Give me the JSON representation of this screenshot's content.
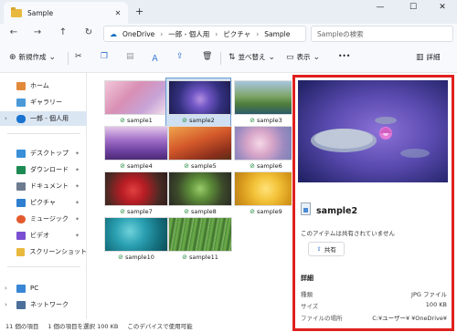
{
  "titlebar": {
    "tab_label": "Sample",
    "tab_close": "✕",
    "new_tab": "+",
    "minimize": "—",
    "maximize": "☐",
    "close": "✕"
  },
  "nav": {
    "back": "←",
    "forward": "→",
    "up": "↑",
    "refresh": "↻",
    "breadcrumb": [
      "OneDrive",
      "一郎 - 個人用",
      "ピクチャ",
      "Sample"
    ],
    "search_placeholder": "Sampleの検索"
  },
  "toolbar": {
    "new_label": "新規作成",
    "sort_label": "並べ替え",
    "view_label": "表示",
    "more": "•••",
    "details_label": "詳細"
  },
  "sidebar": {
    "items": [
      {
        "label": "ホーム",
        "icon": "home-icon"
      },
      {
        "label": "ギャラリー",
        "icon": "gallery-icon"
      },
      {
        "label": "一郎 - 個人用",
        "icon": "onedrive-icon"
      },
      {
        "label": "デスクトップ",
        "icon": "desktop-icon"
      },
      {
        "label": "ダウンロード",
        "icon": "download-icon"
      },
      {
        "label": "ドキュメント",
        "icon": "document-icon"
      },
      {
        "label": "ピクチャ",
        "icon": "pictures-icon"
      },
      {
        "label": "ミュージック",
        "icon": "music-icon"
      },
      {
        "label": "ビデオ",
        "icon": "video-icon"
      },
      {
        "label": "スクリーンショット",
        "icon": "folder-icon"
      },
      {
        "label": "PC",
        "icon": "pc-icon"
      },
      {
        "label": "ネットワーク",
        "icon": "network-icon"
      }
    ]
  },
  "files": [
    {
      "name": "sample1"
    },
    {
      "name": "sample2"
    },
    {
      "name": "sample3"
    },
    {
      "name": "sample4"
    },
    {
      "name": "sample5"
    },
    {
      "name": "sample6"
    },
    {
      "name": "sample7"
    },
    {
      "name": "sample8"
    },
    {
      "name": "sample9"
    },
    {
      "name": "sample10"
    },
    {
      "name": "sample11"
    }
  ],
  "details": {
    "file_name": "sample2",
    "share_status": "このアイテムは共有されていません",
    "share_button": "共有",
    "section_title": "詳細",
    "rows": [
      {
        "label": "種類",
        "value": "JPG ファイル"
      },
      {
        "label": "サイズ",
        "value": "100 KB"
      },
      {
        "label": "ファイルの場所",
        "value": "C:¥ユーザー¥       ¥OneDrive¥"
      }
    ]
  },
  "status": {
    "count": "11 個の項目",
    "selected": "1 個の項目を選択  100 KB",
    "availability": "このデバイスで使用可能"
  },
  "colors": {
    "highlight": "#e0201e",
    "accent": "#0a6cc2"
  }
}
